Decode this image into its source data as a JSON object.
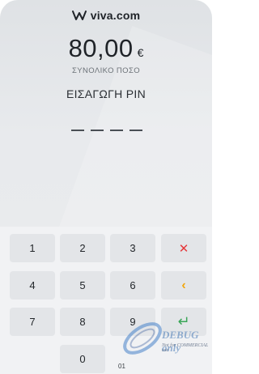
{
  "brand": {
    "name": "viva.com",
    "logo_icon": "viva-w-logo-icon"
  },
  "payment": {
    "amount": "80,00",
    "currency": "€",
    "amount_label": "ΣΥΝΟΛΙΚΟ ΠΟΣΟ",
    "pin_prompt": "ΕΙΣΑΓΩΓΗ PIN",
    "pin_length": 4
  },
  "keypad": {
    "keys": [
      "1",
      "2",
      "3",
      "4",
      "5",
      "6",
      "7",
      "8",
      "9",
      "0"
    ],
    "clear_symbol": "✕",
    "back_symbol": "‹",
    "ok_symbol": "↵",
    "sub_label": "01"
  },
  "watermark": {
    "main": "DEBUG only",
    "sub": "Not for COMMERCIAL use"
  },
  "colors": {
    "clear": "#e5383b",
    "backspace": "#f2a60c",
    "ok": "#3aa657",
    "key_bg": "#e3e5e8",
    "panel_bg": "#e5e7ea"
  }
}
